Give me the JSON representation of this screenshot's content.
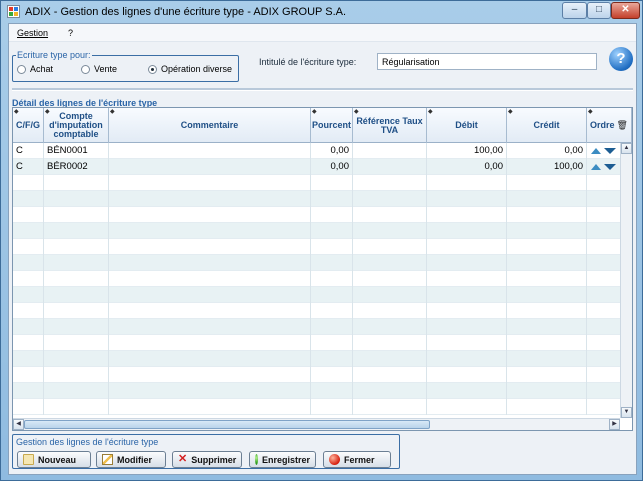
{
  "window": {
    "title": "ADIX - Gestion des lignes d'une écriture type - ADIX GROUP S.A.",
    "controls": {
      "minimize": "–",
      "maximize": "□",
      "close": "✕"
    }
  },
  "menu": {
    "items": [
      "Gestion",
      "?"
    ]
  },
  "type_group": {
    "legend": "Ecriture type pour:",
    "options": [
      {
        "label": "Achat",
        "selected": false
      },
      {
        "label": "Vente",
        "selected": false
      },
      {
        "label": "Opération diverse",
        "selected": true
      }
    ]
  },
  "libelle": {
    "label": "Intitulé de l'écriture type:",
    "value": "Régularisation"
  },
  "help_icon": "?",
  "detail": {
    "label": "Détail des lignes de l'écriture type",
    "columns": [
      "C/F/G",
      "Compte d'imputation comptable",
      "Commentaire",
      "Pourcent",
      "Référence Taux TVA",
      "Débit",
      "Crédit",
      "Ordre"
    ],
    "rows": [
      {
        "cfg": "C",
        "compte": "BÉN0001",
        "commentaire": "",
        "pourcent": "0,00",
        "tva": "",
        "debit": "100,00",
        "credit": "0,00"
      },
      {
        "cfg": "C",
        "compte": "BÉR0002",
        "commentaire": "",
        "pourcent": "0,00",
        "tva": "",
        "debit": "0,00",
        "credit": "100,00"
      }
    ]
  },
  "actions": {
    "legend": "Gestion des lignes de l'écriture type",
    "buttons": [
      "Nouveau",
      "Modifier",
      "Supprimer",
      "Enregistrer",
      "Fermer"
    ]
  },
  "colors": {
    "accent": "#2a64a7",
    "row_alt": "#e8f2f4",
    "title_bar": "#a9cde9"
  }
}
